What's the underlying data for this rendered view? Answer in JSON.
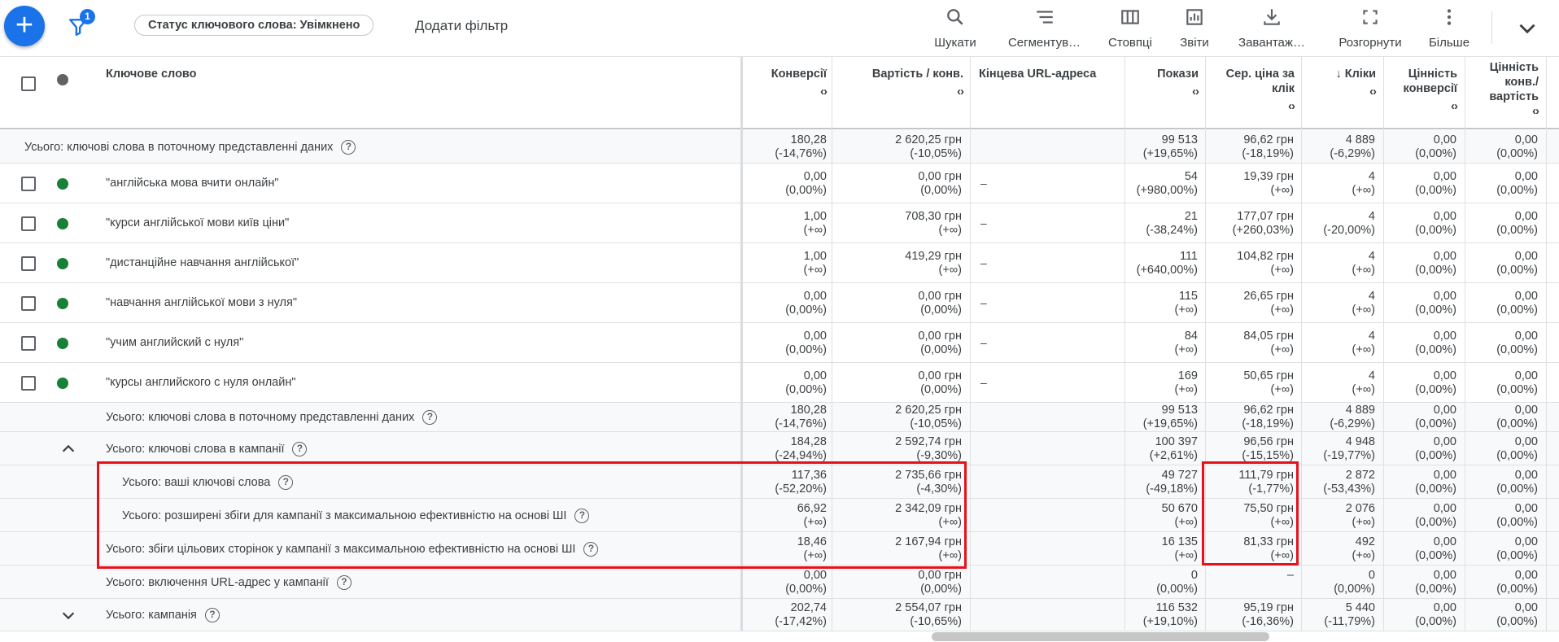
{
  "toolbar": {
    "add_symbol": "+",
    "filter_count": "1",
    "status_chip": "Статус ключового слова: Увімкнено",
    "add_filter": "Додати фільтр",
    "tools": [
      {
        "label": "Шукати",
        "icon": "search-icon"
      },
      {
        "label": "Сегментув…",
        "icon": "segment-icon"
      },
      {
        "label": "Стовпці",
        "icon": "columns-icon"
      },
      {
        "label": "Звіти",
        "icon": "reports-icon"
      },
      {
        "label": "Завантаж…",
        "icon": "download-icon"
      },
      {
        "label": "Розгорнути",
        "icon": "expand-icon"
      },
      {
        "label": "Більше",
        "icon": "more-vert-icon"
      }
    ],
    "chevron": "chevron-down-icon"
  },
  "headers": {
    "keyword": "Ключове слово",
    "conversions": "Конверсії",
    "cost_conv": "Вартість / конв.",
    "final_url": "Кінцева URL-адреса",
    "impressions": "Покази",
    "avg_cpc_1": "Сер. ціна за",
    "avg_cpc_2": "клік",
    "clicks": "Кліки",
    "clicks_sort": "↓",
    "conv_value_1": "Цінність",
    "conv_value_2": "конверсії",
    "conv_value_cost_1": "Цінність",
    "conv_value_cost_2": "конв./",
    "conv_value_cost_3": "вартість",
    "sorter": "‹›"
  },
  "rows": [
    {
      "type": "total-top",
      "label": "Усього: ключові слова в поточному представленні даних",
      "conv": [
        "180,28",
        "(-14,76%)"
      ],
      "cost": [
        "2 620,25 грн",
        "(-10,05%)"
      ],
      "url": "",
      "impr": [
        "99 513",
        "(+19,65%)"
      ],
      "cpc": [
        "96,62 грн",
        "(-18,19%)"
      ],
      "clicks": [
        "4 889",
        "(-6,29%)"
      ],
      "cv": [
        "0,00",
        "(0,00%)"
      ],
      "cvc": [
        "0,00",
        "(0,00%)"
      ]
    },
    {
      "type": "keyword",
      "label": "\"англійська мова вчити онлайн\"",
      "conv": [
        "0,00",
        "(0,00%)"
      ],
      "cost": [
        "0,00 грн",
        "(0,00%)"
      ],
      "url": "–",
      "impr": [
        "54",
        "(+980,00%)"
      ],
      "cpc": [
        "19,39 грн",
        "(+∞)"
      ],
      "clicks": [
        "4",
        "(+∞)"
      ],
      "cv": [
        "0,00",
        "(0,00%)"
      ],
      "cvc": [
        "0,00",
        "(0,00%)"
      ]
    },
    {
      "type": "keyword",
      "label": "\"курси англійської мови київ ціни\"",
      "conv": [
        "1,00",
        "(+∞)"
      ],
      "cost": [
        "708,30 грн",
        "(+∞)"
      ],
      "url": "–",
      "impr": [
        "21",
        "(-38,24%)"
      ],
      "cpc": [
        "177,07 грн",
        "(+260,03%)"
      ],
      "clicks": [
        "4",
        "(-20,00%)"
      ],
      "cv": [
        "0,00",
        "(0,00%)"
      ],
      "cvc": [
        "0,00",
        "(0,00%)"
      ]
    },
    {
      "type": "keyword",
      "label": "\"дистанційне навчання англійської\"",
      "conv": [
        "1,00",
        "(+∞)"
      ],
      "cost": [
        "419,29 грн",
        "(+∞)"
      ],
      "url": "–",
      "impr": [
        "111",
        "(+640,00%)"
      ],
      "cpc": [
        "104,82 грн",
        "(+∞)"
      ],
      "clicks": [
        "4",
        "(+∞)"
      ],
      "cv": [
        "0,00",
        "(0,00%)"
      ],
      "cvc": [
        "0,00",
        "(0,00%)"
      ]
    },
    {
      "type": "keyword",
      "label": "\"навчання англійської мови з нуля\"",
      "conv": [
        "0,00",
        "(0,00%)"
      ],
      "cost": [
        "0,00 грн",
        "(0,00%)"
      ],
      "url": "–",
      "impr": [
        "115",
        "(+∞)"
      ],
      "cpc": [
        "26,65 грн",
        "(+∞)"
      ],
      "clicks": [
        "4",
        "(+∞)"
      ],
      "cv": [
        "0,00",
        "(0,00%)"
      ],
      "cvc": [
        "0,00",
        "(0,00%)"
      ]
    },
    {
      "type": "keyword",
      "label": "\"учим английский с нуля\"",
      "conv": [
        "0,00",
        "(0,00%)"
      ],
      "cost": [
        "0,00 грн",
        "(0,00%)"
      ],
      "url": "–",
      "impr": [
        "84",
        "(+∞)"
      ],
      "cpc": [
        "84,05 грн",
        "(+∞)"
      ],
      "clicks": [
        "4",
        "(+∞)"
      ],
      "cv": [
        "0,00",
        "(0,00%)"
      ],
      "cvc": [
        "0,00",
        "(0,00%)"
      ]
    },
    {
      "type": "keyword",
      "label": "\"курсы английского с нуля онлайн\"",
      "conv": [
        "0,00",
        "(0,00%)"
      ],
      "cost": [
        "0,00 грн",
        "(0,00%)"
      ],
      "url": "–",
      "impr": [
        "169",
        "(+∞)"
      ],
      "cpc": [
        "50,65 грн",
        "(+∞)"
      ],
      "clicks": [
        "4",
        "(+∞)"
      ],
      "cv": [
        "0,00",
        "(0,00%)"
      ],
      "cvc": [
        "0,00",
        "(0,00%)"
      ]
    },
    {
      "type": "total",
      "label": "Усього: ключові слова в поточному представленні даних",
      "conv": [
        "180,28",
        "(-14,76%)"
      ],
      "cost": [
        "2 620,25 грн",
        "(-10,05%)"
      ],
      "url": "",
      "impr": [
        "99 513",
        "(+19,65%)"
      ],
      "cpc": [
        "96,62 грн",
        "(-18,19%)"
      ],
      "clicks": [
        "4 889",
        "(-6,29%)"
      ],
      "cv": [
        "0,00",
        "(0,00%)"
      ],
      "cvc": [
        "0,00",
        "(0,00%)"
      ]
    },
    {
      "type": "total-expand",
      "label": "Усього: ключові слова в кампанії",
      "toggle": "up",
      "conv": [
        "184,28",
        "(-24,94%)"
      ],
      "cost": [
        "2 592,74 грн",
        "(-9,30%)"
      ],
      "url": "",
      "impr": [
        "100 397",
        "(+2,61%)"
      ],
      "cpc": [
        "96,56 грн",
        "(-15,15%)"
      ],
      "clicks": [
        "4 948",
        "(-19,77%)"
      ],
      "cv": [
        "0,00",
        "(0,00%)"
      ],
      "cvc": [
        "0,00",
        "(0,00%)"
      ]
    },
    {
      "type": "total-sub",
      "label": "Усього: ваші ключові слова",
      "conv": [
        "117,36",
        "(-52,20%)"
      ],
      "cost": [
        "2 735,66 грн",
        "(-4,30%)"
      ],
      "url": "",
      "impr": [
        "49 727",
        "(-49,18%)"
      ],
      "cpc": [
        "111,79 грн",
        "(-1,77%)"
      ],
      "clicks": [
        "2 872",
        "(-53,43%)"
      ],
      "cv": [
        "0,00",
        "(0,00%)"
      ],
      "cvc": [
        "0,00",
        "(0,00%)"
      ]
    },
    {
      "type": "total-sub",
      "label": "Усього: розширені збіги для кампанії з максимальною ефективністю на основі ШІ",
      "conv": [
        "66,92",
        "(+∞)"
      ],
      "cost": [
        "2 342,09 грн",
        "(+∞)"
      ],
      "url": "",
      "impr": [
        "50 670",
        "(+∞)"
      ],
      "cpc": [
        "75,50 грн",
        "(+∞)"
      ],
      "clicks": [
        "2 076",
        "(+∞)"
      ],
      "cv": [
        "0,00",
        "(0,00%)"
      ],
      "cvc": [
        "0,00",
        "(0,00%)"
      ]
    },
    {
      "type": "total-sub2",
      "label": "Усього: збіги цільових сторінок у кампанії з максимальною ефективністю на основі ШІ",
      "conv": [
        "18,46",
        "(+∞)"
      ],
      "cost": [
        "2 167,94 грн",
        "(+∞)"
      ],
      "url": "",
      "impr": [
        "16 135",
        "(+∞)"
      ],
      "cpc": [
        "81,33 грн",
        "(+∞)"
      ],
      "clicks": [
        "492",
        "(+∞)"
      ],
      "cv": [
        "0,00",
        "(0,00%)"
      ],
      "cvc": [
        "0,00",
        "(0,00%)"
      ]
    },
    {
      "type": "total",
      "label": "Усього: включення URL-адрес у кампанії",
      "conv": [
        "0,00",
        "(0,00%)"
      ],
      "cost": [
        "0,00 грн",
        "(0,00%)"
      ],
      "url": "",
      "impr": [
        "0",
        "(0,00%)"
      ],
      "cpc": [
        "–",
        ""
      ],
      "clicks": [
        "0",
        "(0,00%)"
      ],
      "cv": [
        "0,00",
        "(0,00%)"
      ],
      "cvc": [
        "0,00",
        "(0,00%)"
      ]
    },
    {
      "type": "total-expand",
      "label": "Усього: кампанія",
      "toggle": "down",
      "conv": [
        "202,74",
        "(-17,42%)"
      ],
      "cost": [
        "2 554,07 грн",
        "(-10,65%)"
      ],
      "url": "",
      "impr": [
        "116 532",
        "(+19,10%)"
      ],
      "cpc": [
        "95,19 грн",
        "(-16,36%)"
      ],
      "clicks": [
        "5 440",
        "(-11,79%)"
      ],
      "cv": [
        "0,00",
        "(0,00%)"
      ],
      "cvc": [
        "0,00",
        "(0,00%)"
      ]
    }
  ],
  "help_symbol": "?",
  "colors": {
    "accent": "#1a73e8",
    "status_dot": "#188038",
    "highlight": "#e8101a"
  }
}
